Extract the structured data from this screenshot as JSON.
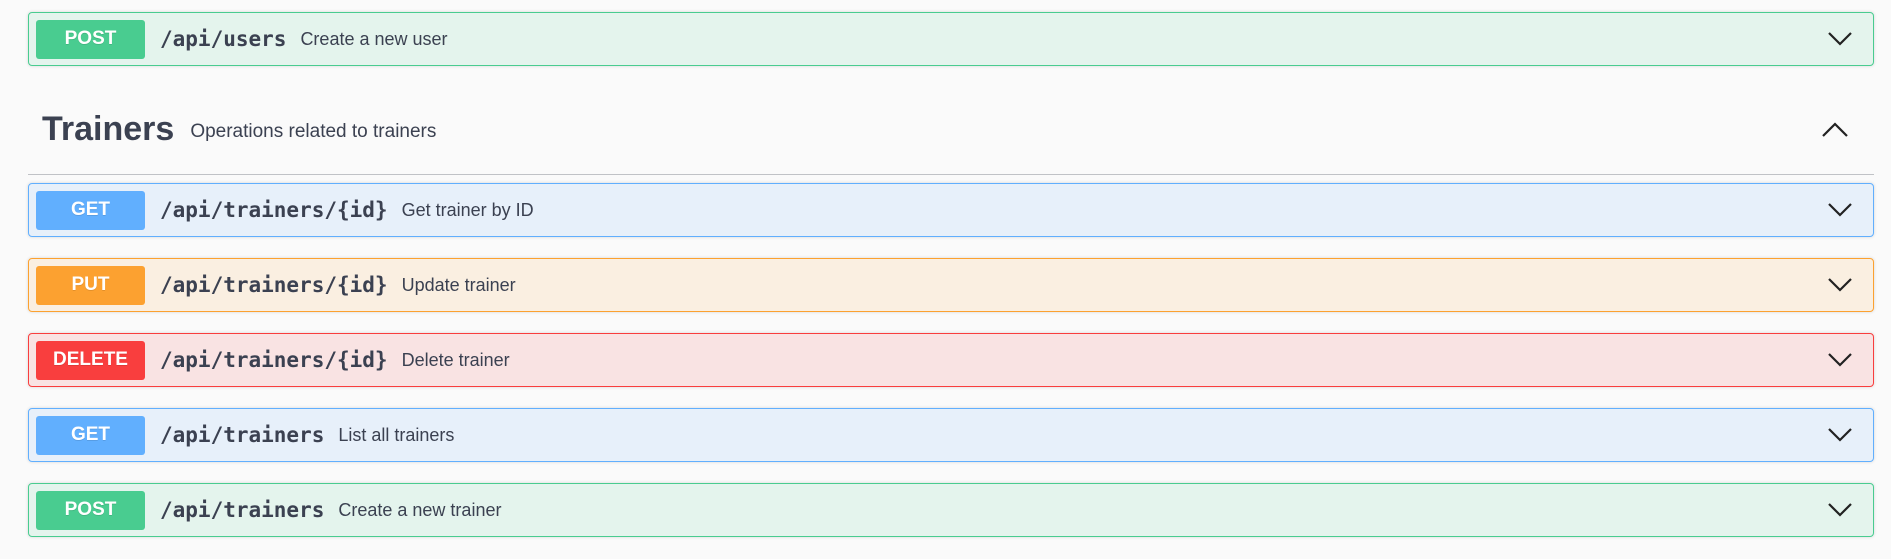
{
  "top_operation": {
    "method": "POST",
    "path": "/api/users",
    "summary": "Create a new user"
  },
  "tag": {
    "name": "Trainers",
    "description": "Operations related to trainers"
  },
  "operations": [
    {
      "method": "GET",
      "path": "/api/trainers/{id}",
      "summary": "Get trainer by ID"
    },
    {
      "method": "PUT",
      "path": "/api/trainers/{id}",
      "summary": "Update trainer"
    },
    {
      "method": "DELETE",
      "path": "/api/trainers/{id}",
      "summary": "Delete trainer"
    },
    {
      "method": "GET",
      "path": "/api/trainers",
      "summary": "List all trainers"
    },
    {
      "method": "POST",
      "path": "/api/trainers",
      "summary": "Create a new trainer"
    }
  ],
  "icons": {
    "expand": "chevron-down-icon",
    "collapse": "chevron-up-icon"
  },
  "colors": {
    "post": "#49cc90",
    "get": "#61affe",
    "put": "#fca130",
    "delete": "#f93e3e",
    "text": "#3b4151"
  }
}
